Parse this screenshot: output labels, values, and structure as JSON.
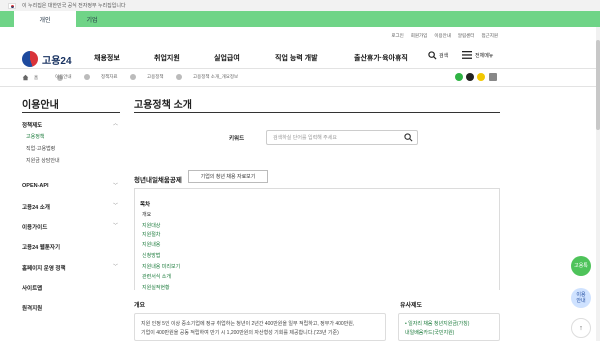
{
  "gov_banner": {
    "text": "이 누리집은 대한민국 공식 전자정부 누리집입니다"
  },
  "tabs": [
    {
      "label": "개인",
      "active": true
    },
    {
      "label": "기업",
      "active": false
    }
  ],
  "util_links": [
    "로그인",
    "회원가입",
    "이용안내",
    "알림센터",
    "접근지원"
  ],
  "logo": {
    "text": "고용24"
  },
  "gnb": [
    "채용정보",
    "취업지원",
    "실업급여",
    "직업 능력 개발",
    "출산휴가·육아휴직"
  ],
  "header": {
    "search_label": "검색",
    "menu_label": "전체메뉴"
  },
  "breadcrumb": [
    "홈",
    "이용안내",
    "정책자료",
    "고용정책",
    "고용정책 소개_개요정보"
  ],
  "sidebar": {
    "title": "이용안내",
    "sections": [
      {
        "label": "정책제도",
        "sub": [
          {
            "label": "고용정책",
            "active": true
          },
          {
            "label": "직업·고용법령",
            "active": false
          },
          {
            "label": "지원금 상담안내",
            "active": false
          }
        ]
      },
      {
        "label": "OPEN-API",
        "sub": []
      },
      {
        "label": "고용24 소개",
        "sub": []
      },
      {
        "label": "이용가이드",
        "sub": []
      },
      {
        "label": "고용24 웹툰자기",
        "sub": []
      },
      {
        "label": "홈페이지 운영 정책",
        "sub": []
      },
      {
        "label": "사이트맵",
        "sub": []
      },
      {
        "label": "원격지원",
        "sub": []
      }
    ]
  },
  "main": {
    "title": "고용정책 소개",
    "keyword_label": "키워드",
    "keyword_placeholder": "검색하실 단어를 입력해 주세요",
    "section_title": "청년내일채움공제",
    "section_button": "기업의 청년 채용 자료보기",
    "toc_title": "목차",
    "toc": [
      "개요",
      "지원대상",
      "지원절차",
      "지원내용",
      "신청방법",
      "지원내용 미리보기",
      "관련서식 소개",
      "지원실적현황"
    ],
    "overview_title": "개요",
    "overview_text_1": "지원 인정 5인 이상 중소기업에 정규 취업하는 청년이 2년간 400만원을 일부 적립하고, 정부가 400만원,",
    "overview_text_2": "기업이 400만원을 공동 적립하여 만기 시 1,200만원의 자산형성 기회를 제공합니다.('23년 기준)",
    "related_title": "유사제도",
    "related_links": [
      "• 일자리 채움 청년지원금(가칭)",
      "내일배움카드(국민지원)"
    ]
  },
  "floating": {
    "chat": "고용톡",
    "guide_1": "이용",
    "guide_2": "안내",
    "top": "↑"
  },
  "colors": {
    "tab_bar": "#6fd487",
    "accent": "#1a7a3a",
    "navy": "#16305f"
  }
}
